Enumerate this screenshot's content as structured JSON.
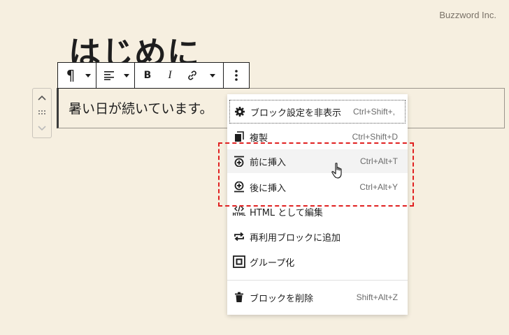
{
  "brand": "Buzzword Inc.",
  "page": {
    "title": "はじめに"
  },
  "block": {
    "text": "暑い日が続いています。"
  },
  "toolbar": {
    "paragraph": "¶",
    "bold": "B",
    "italic": "I"
  },
  "menu": {
    "items": [
      {
        "label": "ブロック設定を非表示",
        "shortcut": "Ctrl+Shift+,",
        "icon": "gear-icon"
      },
      {
        "label": "複製",
        "shortcut": "Ctrl+Shift+D",
        "icon": "duplicate-icon"
      },
      {
        "label": "前に挿入",
        "shortcut": "Ctrl+Alt+T",
        "icon": "insert-before-icon"
      },
      {
        "label": "後に挿入",
        "shortcut": "Ctrl+Alt+Y",
        "icon": "insert-after-icon"
      },
      {
        "label": "HTML として編集",
        "shortcut": "",
        "icon": "html-icon"
      },
      {
        "label": "再利用ブロックに追加",
        "shortcut": "",
        "icon": "reusable-icon"
      },
      {
        "label": "グループ化",
        "shortcut": "",
        "icon": "group-icon"
      },
      {
        "label": "ブロックを削除",
        "shortcut": "Shift+Alt+Z",
        "icon": "trash-icon"
      }
    ],
    "html_icon_text": "HTML"
  },
  "colors": {
    "highlight": "#e02020",
    "background": "#f6efe0"
  }
}
